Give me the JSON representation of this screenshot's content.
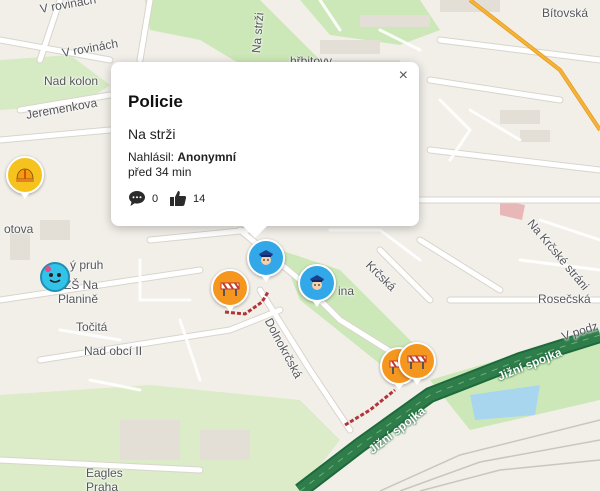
{
  "map": {
    "streets": [
      "V rovinách",
      "V rovinách",
      "Nad kolon",
      "Jeremenkova",
      "Na strži",
      "hřbitovy",
      "Bítovská",
      "otova",
      "ý pruh",
      "ZŠ Na",
      "Planině",
      "Točitá",
      "Nad obcí II",
      "Krčská",
      "ina",
      "Na Krčské stráni",
      "Rosečská",
      "V podz",
      "Dolnokrčská",
      "Jižní spojka",
      "Jižní spojka",
      "Eagles",
      "Praha"
    ]
  },
  "popup": {
    "title": "Policie",
    "close": "×",
    "street": "Na strži",
    "reporter_label": "Nahlásil:",
    "reporter_name": "Anonymní",
    "time": "před 34 min",
    "comments": "0",
    "thumbs": "14"
  },
  "markers": [
    {
      "type": "police",
      "icon": "police-officer-icon",
      "color": "#33a8e8"
    },
    {
      "type": "police",
      "icon": "police-officer-icon",
      "color": "#33a8e8"
    },
    {
      "type": "roadwork",
      "icon": "road-barrier-icon",
      "color": "#f5961f"
    },
    {
      "type": "roadwork",
      "icon": "road-barrier-icon",
      "color": "#f5961f"
    },
    {
      "type": "roadwork",
      "icon": "road-barrier-icon",
      "color": "#f5961f"
    },
    {
      "type": "hazard",
      "icon": "hard-hat-icon",
      "color": "#f6c21d"
    },
    {
      "type": "wazer",
      "icon": "wazer-avatar-icon",
      "color": "#33c3e8"
    }
  ],
  "colors": {
    "land": "#f2efe9",
    "park": "#cde8b8",
    "road": "#ffffff",
    "road_outline": "#d9d5cd",
    "motorway": "#2f7d4a",
    "arterial": "#f5b33b",
    "water": "#a9d6ef",
    "closure": "#b0353a"
  }
}
